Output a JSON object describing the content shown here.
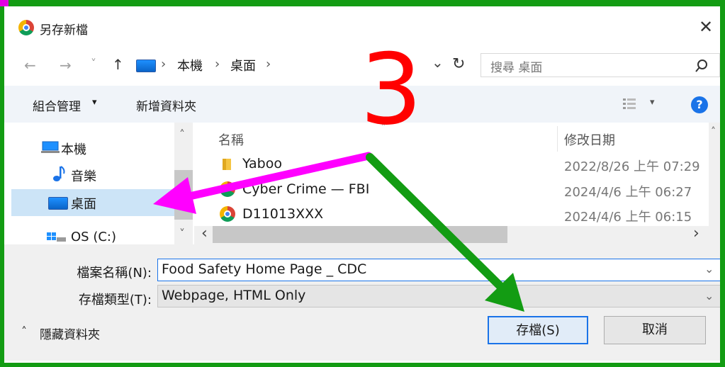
{
  "window": {
    "title": "另存新檔",
    "close_glyph": "✕"
  },
  "navigation": {
    "back_glyph": "←",
    "forward_glyph": "→",
    "recent_glyph": "˅",
    "up_glyph": "↑",
    "breadcrumb": [
      "本機",
      "桌面"
    ],
    "separator": "›",
    "dropdown_glyph": "⌄",
    "refresh_glyph": "↻",
    "search_placeholder": "搜尋 桌面",
    "search_glyph": "⌕"
  },
  "toolbar": {
    "organize_label": "組合管理",
    "organize_caret": "▾",
    "new_folder_label": "新增資料夾",
    "view_caret": "▾",
    "help_glyph": "?"
  },
  "nav_pane": {
    "items": [
      {
        "label": "本機",
        "icon": "computer-icon"
      },
      {
        "label": "音樂",
        "icon": "music-icon"
      },
      {
        "label": "桌面",
        "icon": "desktop-icon",
        "selected": true
      },
      {
        "label": "OS (C:)",
        "icon": "drive-icon"
      }
    ],
    "scroll_up": "˄",
    "scroll_down": "˅"
  },
  "file_list": {
    "columns": [
      "名稱",
      "修改日期"
    ],
    "sort_indicator": "˄",
    "rows": [
      {
        "name": "Yaboo",
        "date": "2022/8/26 上午 07:29",
        "icon": "folder-icon"
      },
      {
        "name": "Cyber Crime — FBI",
        "date": "2024/4/6 上午 06:27",
        "icon": "chrome-icon"
      },
      {
        "name": "D11013XXX",
        "date": "2024/4/6 上午 06:15",
        "icon": "chrome-icon"
      }
    ],
    "hscroll_left": "‹",
    "hscroll_right": "›",
    "vscroll_up": "˄"
  },
  "form": {
    "filename_label": "檔案名稱(N):",
    "filename_value": "Food Safety Home Page _ CDC",
    "filetype_label": "存檔類型(T):",
    "filetype_value": "Webpage, HTML Only",
    "dropdown_glyph": "⌄"
  },
  "footer": {
    "hide_folders_label": "隱藏資料夾",
    "hide_glyph": "˄",
    "save_label": "存檔(S)",
    "cancel_label": "取消"
  },
  "annotation": {
    "step_number": "3",
    "colors": {
      "step": "#ff0000",
      "pink_arrow": "#ff00ff",
      "green_arrow": "#139c13",
      "frame": "#139c13"
    }
  },
  "colors": {
    "accent": "#1a73e8",
    "selected_bg": "#cce4f7",
    "toolbar_bg": "#f0f4f9",
    "bottom_bg": "#f0f0f0"
  }
}
